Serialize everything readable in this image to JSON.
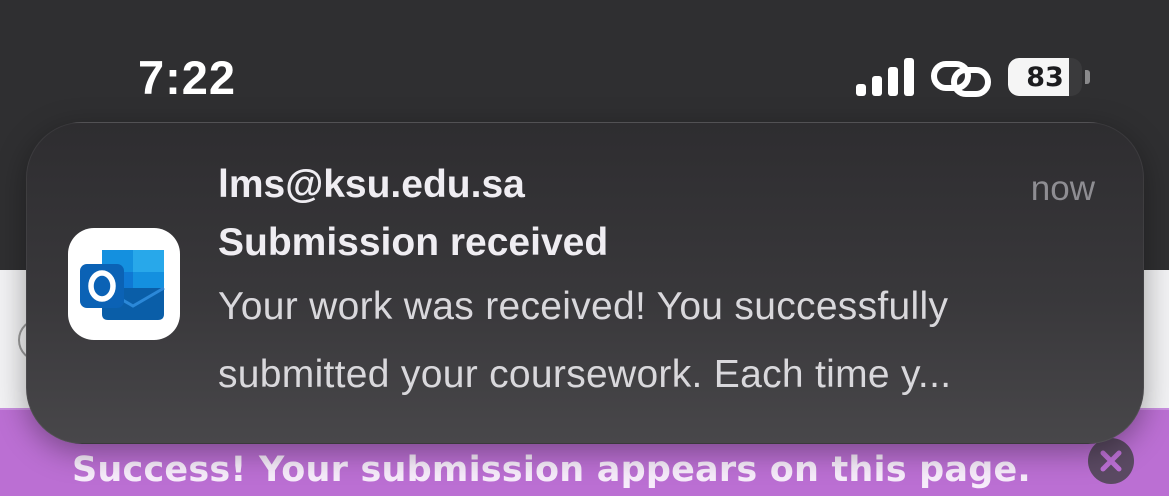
{
  "status_bar": {
    "time": "7:22",
    "signal_icon": "cellular-signal-icon",
    "link_icon": "personal-hotspot-link-icon",
    "battery_percent": 83,
    "battery_label": "83"
  },
  "notification": {
    "app_icon": "outlook-icon",
    "sender": "lms@ksu.edu.sa",
    "timestamp": "now",
    "subject": "Submission received",
    "body_line_1": "Your work was received! You successfully",
    "body_line_2": "submitted your coursework. Each time y..."
  },
  "page": {
    "success_message": "Success! Your submission appears on this page.",
    "close_icon": "close-circle-icon",
    "banner_color": "#bb6fd3"
  }
}
